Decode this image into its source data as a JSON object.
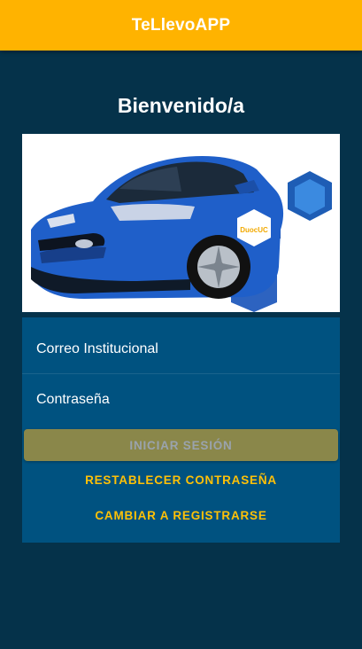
{
  "app": {
    "title": "TeLlevoAPP"
  },
  "welcome": {
    "text": "Bienvenido/a"
  },
  "hero": {
    "logo_text": "DuocUC"
  },
  "form": {
    "email_label": "Correo Institucional",
    "password_label": "Contraseña",
    "login_label": "INICIAR SESIÓN",
    "reset_label": "RESTABLECER CONTRASEÑA",
    "register_label": "CAMBIAR A REGISTRARSE"
  },
  "colors": {
    "background": "#05324a",
    "toolbar": "#ffb300",
    "card": "#005280",
    "button_disabled": "#8a874a",
    "accent_text": "#ffc107"
  }
}
